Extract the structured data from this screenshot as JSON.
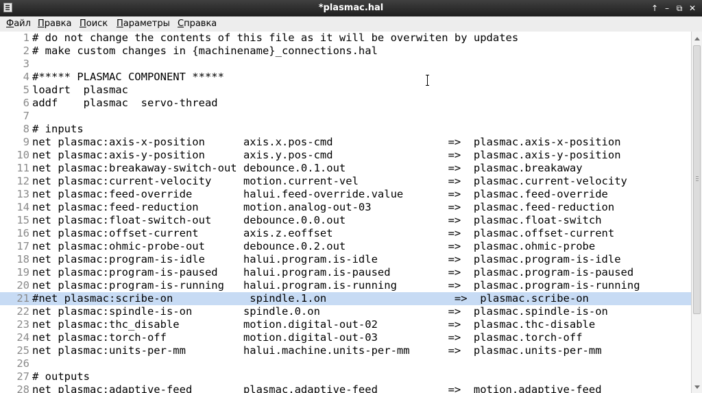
{
  "window": {
    "title": "*plasmac.hal",
    "app_icon": "document-icon",
    "buttons": {
      "pin": "↑",
      "minimize": "–",
      "maximize": "⧉",
      "close": "✕"
    }
  },
  "menu": [
    "Файл",
    "Правка",
    "Поиск",
    "Параметры",
    "Справка"
  ],
  "editor": {
    "highlight_line": 21,
    "lines": [
      {
        "n": "1",
        "text": "# do not change the contents of this file as it will be overwiten by updates"
      },
      {
        "n": "2",
        "text": "# make custom changes in {machinename}_connections.hal"
      },
      {
        "n": "3",
        "text": ""
      },
      {
        "n": "4",
        "text": "#***** PLASMAC COMPONENT *****"
      },
      {
        "n": "5",
        "text": "loadrt  plasmac"
      },
      {
        "n": "6",
        "text": "addf    plasmac  servo-thread"
      },
      {
        "n": "7",
        "text": ""
      },
      {
        "n": "8",
        "text": "# inputs"
      },
      {
        "n": "9",
        "text": "net plasmac:axis-x-position      axis.x.pos-cmd                  =>  plasmac.axis-x-position"
      },
      {
        "n": "10",
        "text": "net plasmac:axis-y-position      axis.y.pos-cmd                  =>  plasmac.axis-y-position"
      },
      {
        "n": "11",
        "text": "net plasmac:breakaway-switch-out debounce.0.1.out                =>  plasmac.breakaway"
      },
      {
        "n": "12",
        "text": "net plasmac:current-velocity     motion.current-vel              =>  plasmac.current-velocity"
      },
      {
        "n": "13",
        "text": "net plasmac:feed-override        halui.feed-override.value       =>  plasmac.feed-override"
      },
      {
        "n": "14",
        "text": "net plasmac:feed-reduction       motion.analog-out-03            =>  plasmac.feed-reduction"
      },
      {
        "n": "15",
        "text": "net plasmac:float-switch-out     debounce.0.0.out                =>  plasmac.float-switch"
      },
      {
        "n": "16",
        "text": "net plasmac:offset-current       axis.z.eoffset                  =>  plasmac.offset-current"
      },
      {
        "n": "17",
        "text": "net plasmac:ohmic-probe-out      debounce.0.2.out                =>  plasmac.ohmic-probe"
      },
      {
        "n": "18",
        "text": "net plasmac:program-is-idle      halui.program.is-idle           =>  plasmac.program-is-idle"
      },
      {
        "n": "19",
        "text": "net plasmac:program-is-paused    halui.program.is-paused         =>  plasmac.program-is-paused"
      },
      {
        "n": "20",
        "text": "net plasmac:program-is-running   halui.program.is-running        =>  plasmac.program-is-running"
      },
      {
        "n": "21",
        "text": "#net plasmac:scribe-on            spindle.1.on                    =>  plasmac.scribe-on"
      },
      {
        "n": "22",
        "text": "net plasmac:spindle-is-on        spindle.0.on                    =>  plasmac.spindle-is-on"
      },
      {
        "n": "23",
        "text": "net plasmac:thc_disable          motion.digital-out-02           =>  plasmac.thc-disable"
      },
      {
        "n": "24",
        "text": "net plasmac:torch-off            motion.digital-out-03           =>  plasmac.torch-off"
      },
      {
        "n": "25",
        "text": "net plasmac:units-per-mm         halui.machine.units-per-mm      =>  plasmac.units-per-mm"
      },
      {
        "n": "26",
        "text": ""
      },
      {
        "n": "27",
        "text": "# outputs"
      },
      {
        "n": "28",
        "text": "net plasmac:adaptive-feed        plasmac.adaptive-feed           =>  motion.adaptive-feed"
      }
    ]
  },
  "colors": {
    "highlight": "#c7dbf4",
    "line_numbers": "#8a8a8a",
    "titlebar": "#2b2b2b"
  }
}
